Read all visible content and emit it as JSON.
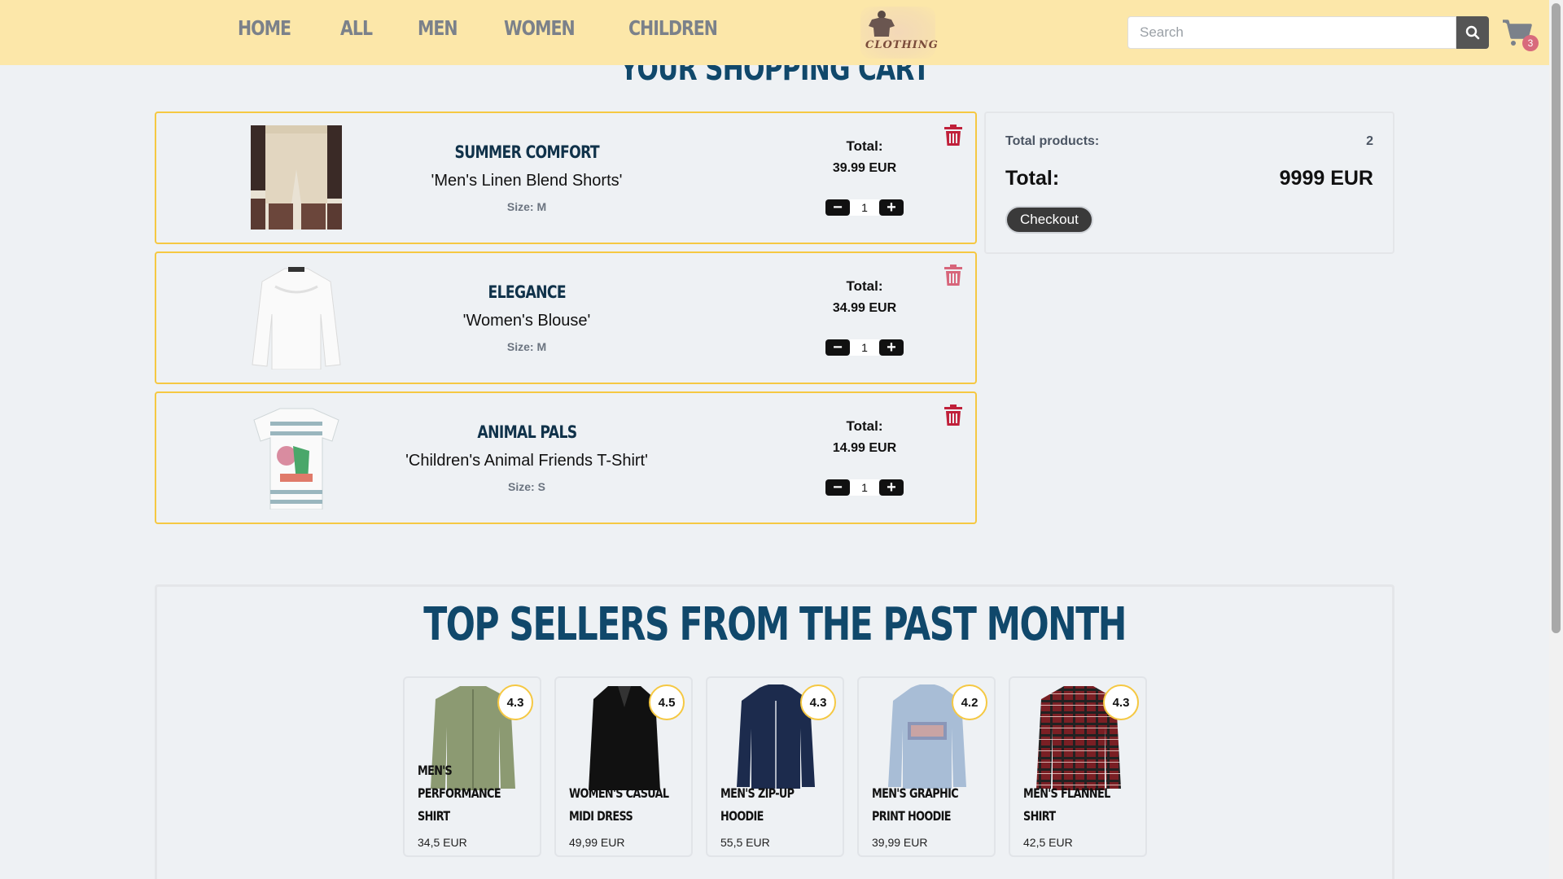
{
  "nav": {
    "items": [
      "HOME",
      "ALL",
      "MEN",
      "WOMEN",
      "CHILDREN"
    ]
  },
  "logo": {
    "text": "CLOTHING"
  },
  "search": {
    "placeholder": "Search",
    "value": ""
  },
  "cart": {
    "count": "3"
  },
  "page": {
    "title": "YOUR SHOPPING CART"
  },
  "items": [
    {
      "brand": "SUMMER COMFORT",
      "name": "'Men's Linen Blend Shorts'",
      "size": "Size: M",
      "total_label": "Total:",
      "total": "39.99 EUR",
      "qty": "1"
    },
    {
      "brand": "ELEGANCE",
      "name": "'Women's Blouse'",
      "size": "Size: M",
      "total_label": "Total:",
      "total": "34.99 EUR",
      "qty": "1"
    },
    {
      "brand": "ANIMAL PALS",
      "name": "'Children's Animal Friends T-Shirt'",
      "size": "Size: S",
      "total_label": "Total:",
      "total": "14.99 EUR",
      "qty": "1"
    }
  ],
  "summary": {
    "total_products_label": "Total products:",
    "total_products": "2",
    "total_label": "Total:",
    "total": "9999 EUR",
    "checkout_label": "Checkout"
  },
  "top_sellers": {
    "title": "TOP SELLERS FROM THE PAST MONTH",
    "products": [
      {
        "name": "MEN'S PERFORMANCE SHIRT",
        "price": "34,5 EUR",
        "rating": "4.3"
      },
      {
        "name": "WOMEN'S CASUAL MIDI DRESS",
        "price": "49,99 EUR",
        "rating": "4.5"
      },
      {
        "name": "MEN'S ZIP-UP HOODIE",
        "price": "55,5 EUR",
        "rating": "4.3"
      },
      {
        "name": "MEN'S GRAPHIC PRINT HOODIE",
        "price": "39,99 EUR",
        "rating": "4.2"
      },
      {
        "name": "MEN'S FLANNEL SHIRT",
        "price": "42,5 EUR",
        "rating": "4.3"
      }
    ]
  },
  "colors": {
    "header_bg": "#fce7a9",
    "accent_yellow": "#f5c842",
    "title_blue": "#10486b",
    "trash_red": "#c0203a",
    "badge_pink": "#d86a7c"
  }
}
